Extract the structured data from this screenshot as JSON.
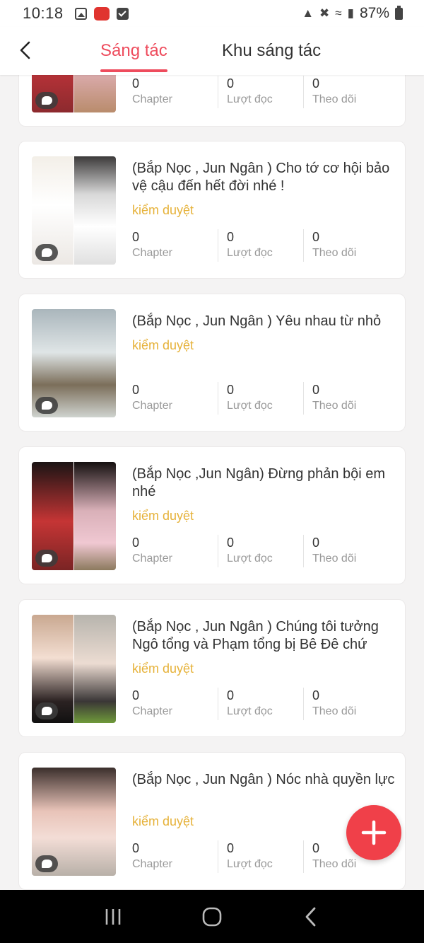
{
  "status_bar": {
    "time": "10:18",
    "battery": "87%",
    "icons": [
      "image-icon",
      "manga-toon-app-icon",
      "check-icon",
      "lock-icon",
      "mute-icon",
      "wifi-icon",
      "signal-icon",
      "battery-icon"
    ]
  },
  "header": {
    "back_icon": "chevron-left-icon",
    "tabs": [
      {
        "label": "Sáng tác",
        "active": true
      },
      {
        "label": "Khu sáng tác",
        "active": false
      }
    ]
  },
  "colors": {
    "accent": "#ee4c5d",
    "status": "#e6b23a",
    "fab": "#f04049"
  },
  "works": [
    {
      "title": "",
      "status": "",
      "stats": [
        {
          "value": "0",
          "label": "Chapter"
        },
        {
          "value": "0",
          "label": "Lượt đọc"
        },
        {
          "value": "0",
          "label": "Theo dõi"
        }
      ]
    },
    {
      "title": "(Bắp Nọc , Jun Ngân ) Cho tớ cơ hội bảo vệ cậu đến hết đời nhé !",
      "status": "kiểm duyệt",
      "stats": [
        {
          "value": "0",
          "label": "Chapter"
        },
        {
          "value": "0",
          "label": "Lượt đọc"
        },
        {
          "value": "0",
          "label": "Theo dõi"
        }
      ]
    },
    {
      "title": "(Bắp Nọc , Jun Ngân ) Yêu nhau từ nhỏ",
      "status": "kiểm duyệt",
      "stats": [
        {
          "value": "0",
          "label": "Chapter"
        },
        {
          "value": "0",
          "label": "Lượt đọc"
        },
        {
          "value": "0",
          "label": "Theo dõi"
        }
      ]
    },
    {
      "title": "(Bắp Nọc ,Jun Ngân) Đừng phản bội em nhé",
      "status": "kiểm duyệt",
      "stats": [
        {
          "value": "0",
          "label": "Chapter"
        },
        {
          "value": "0",
          "label": "Lượt đọc"
        },
        {
          "value": "0",
          "label": "Theo dõi"
        }
      ]
    },
    {
      "title": "(Bắp Nọc , Jun Ngân ) Chúng tôi tưởng Ngô tổng và Phạm tổng bị Bê Đê chứ",
      "status": "kiểm duyệt",
      "stats": [
        {
          "value": "0",
          "label": "Chapter"
        },
        {
          "value": "0",
          "label": "Lượt đọc"
        },
        {
          "value": "0",
          "label": "Theo dõi"
        }
      ]
    },
    {
      "title": "(Bắp Nọc , Jun Ngân ) Nóc nhà quyền lực",
      "status": "kiểm duyệt",
      "stats": [
        {
          "value": "0",
          "label": "Chapter"
        },
        {
          "value": "0",
          "label": "Lượt đọc"
        },
        {
          "value": "0",
          "label": "Theo dõi"
        }
      ]
    }
  ],
  "fab_icon": "plus-icon",
  "nav": {
    "icons": [
      "recent-apps-icon",
      "home-icon",
      "back-icon"
    ]
  }
}
